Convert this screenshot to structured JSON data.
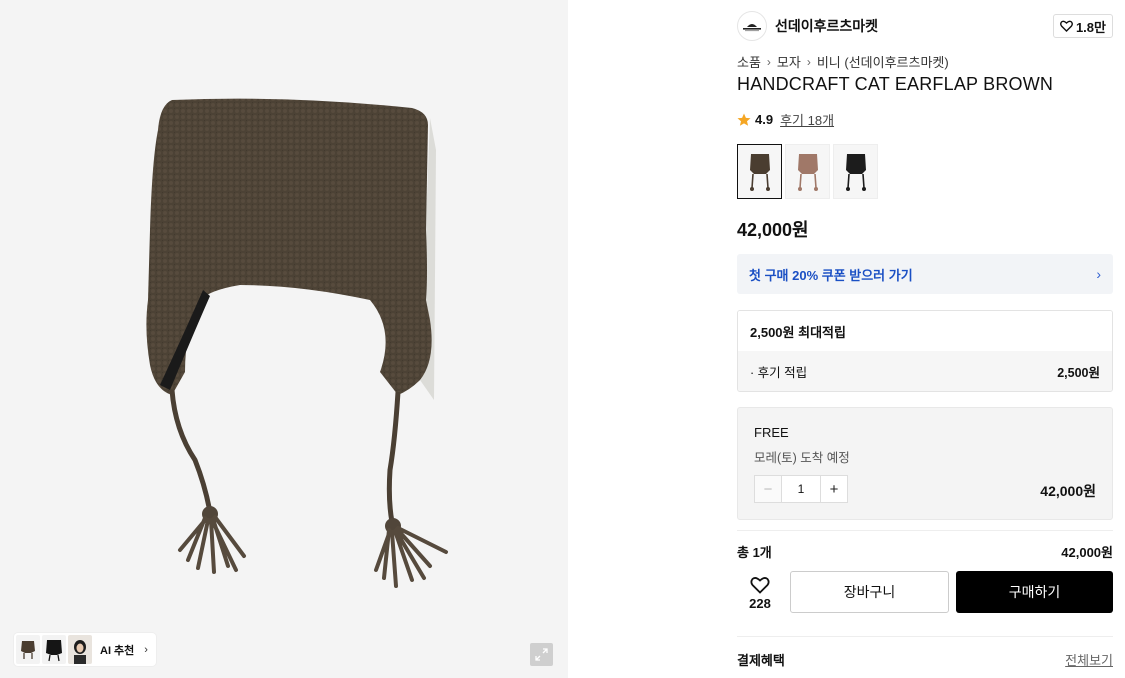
{
  "gallery": {
    "ai_label": "AI 추천",
    "thumbnails": [
      "hat-brown",
      "hat-black",
      "model-photo"
    ]
  },
  "brand": {
    "name": "선데이후르츠마켓",
    "logo_text": "SUNDAYFRUITSMARKET",
    "likes": "1.8만"
  },
  "breadcrumb": [
    "소품",
    "모자",
    "비니 (선데이후르츠마켓)"
  ],
  "product": {
    "title": "HANDCRAFT CAT EARFLAP BROWN",
    "rating": "4.9",
    "reviews": "후기 18개",
    "price": "42,000원",
    "swatches": [
      "brown",
      "pink",
      "black"
    ],
    "colors": {
      "brown": "#4a3d30",
      "pink": "#a07868",
      "black": "#1c1c1c"
    }
  },
  "coupon": {
    "label": "첫 구매 20% 쿠폰 받으러 가기"
  },
  "points": {
    "header": "2,500원 최대적립",
    "row_label": "· 후기 적립",
    "row_value": "2,500원"
  },
  "option": {
    "name": "FREE",
    "delivery": "모레(토) 도착 예정",
    "quantity": "1",
    "price": "42,000원"
  },
  "total": {
    "label": "총 1개",
    "value": "42,000원"
  },
  "actions": {
    "wish_count": "228",
    "cart_label": "장바구니",
    "buy_label": "구매하기"
  },
  "benefits": {
    "title": "결제혜택",
    "view_all": "전체보기"
  }
}
